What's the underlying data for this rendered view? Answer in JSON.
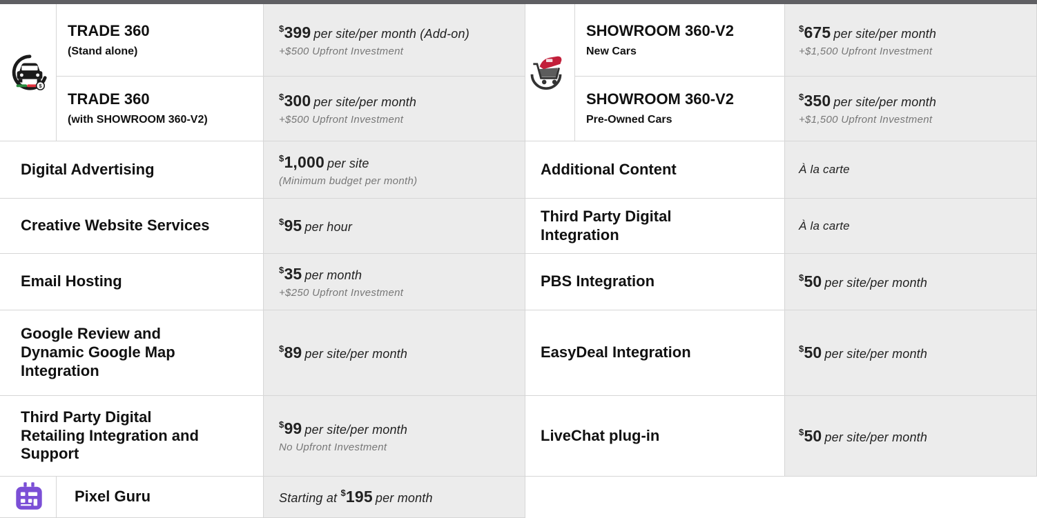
{
  "trade": {
    "icon": "car-trade-icon",
    "standalone": {
      "title": "TRADE 360",
      "subtitle": "(Stand alone)",
      "currency": "$",
      "amount": "399",
      "unit": "per site/per month (Add-on)",
      "note": "+$500 Upfront Investment"
    },
    "with_showroom": {
      "title": "TRADE 360",
      "subtitle": "(with SHOWROOM 360-V2)",
      "currency": "$",
      "amount": "300",
      "unit": "per site/per month",
      "note": "+$500 Upfront Investment"
    }
  },
  "showroom": {
    "icon": "car-cart-icon",
    "new": {
      "title": "SHOWROOM 360-V2",
      "subtitle": "New Cars",
      "currency": "$",
      "amount": "675",
      "unit": "per site/per month",
      "note": "+$1,500 Upfront Investment"
    },
    "preowned": {
      "title": "SHOWROOM 360-V2",
      "subtitle": "Pre-Owned Cars",
      "currency": "$",
      "amount": "350",
      "unit": "per site/per month",
      "note": "+$1,500 Upfront Investment"
    }
  },
  "left_services": [
    {
      "label": "Digital Advertising",
      "currency": "$",
      "amount": "1,000",
      "unit": "per site",
      "note": "(Minimum budget per month)"
    },
    {
      "label": "Creative Website Services",
      "currency": "$",
      "amount": "95",
      "unit": "per hour",
      "note": ""
    },
    {
      "label": "Email Hosting",
      "currency": "$",
      "amount": "35",
      "unit": "per month",
      "note": "+$250 Upfront Investment"
    },
    {
      "label": "Google Review and Dynamic Google Map Integration",
      "currency": "$",
      "amount": "89",
      "unit": "per site/per month",
      "note": ""
    },
    {
      "label": "Third Party Digital Retailing Integration and Support",
      "currency": "$",
      "amount": "99",
      "unit": "per site/per month",
      "note": "No Upfront Investment"
    }
  ],
  "right_services": [
    {
      "label": "Additional Content",
      "price_text": "À la carte"
    },
    {
      "label": "Third Party Digital Integration",
      "price_text": "À la carte"
    },
    {
      "label": "PBS Integration",
      "currency": "$",
      "amount": "50",
      "unit": "per site/per month"
    },
    {
      "label": "EasyDeal Integration",
      "currency": "$",
      "amount": "50",
      "unit": "per site/per month"
    },
    {
      "label": "LiveChat plug-in",
      "currency": "$",
      "amount": "50",
      "unit": "per site/per month"
    }
  ],
  "pixel_guru": {
    "icon": "pixel-grid-icon",
    "label": "Pixel Guru",
    "prefix": "Starting at",
    "currency": "$",
    "amount": "195",
    "unit": "per month"
  },
  "colors": {
    "header_bar": "#5f5f63",
    "cell_gray": "#ececec",
    "trade_icon_accent": "#e2343f",
    "trade_icon_green": "#2b8a3e",
    "showroom_icon_red": "#c21f3a",
    "pixel_icon_purple": "#7b4fd6"
  }
}
